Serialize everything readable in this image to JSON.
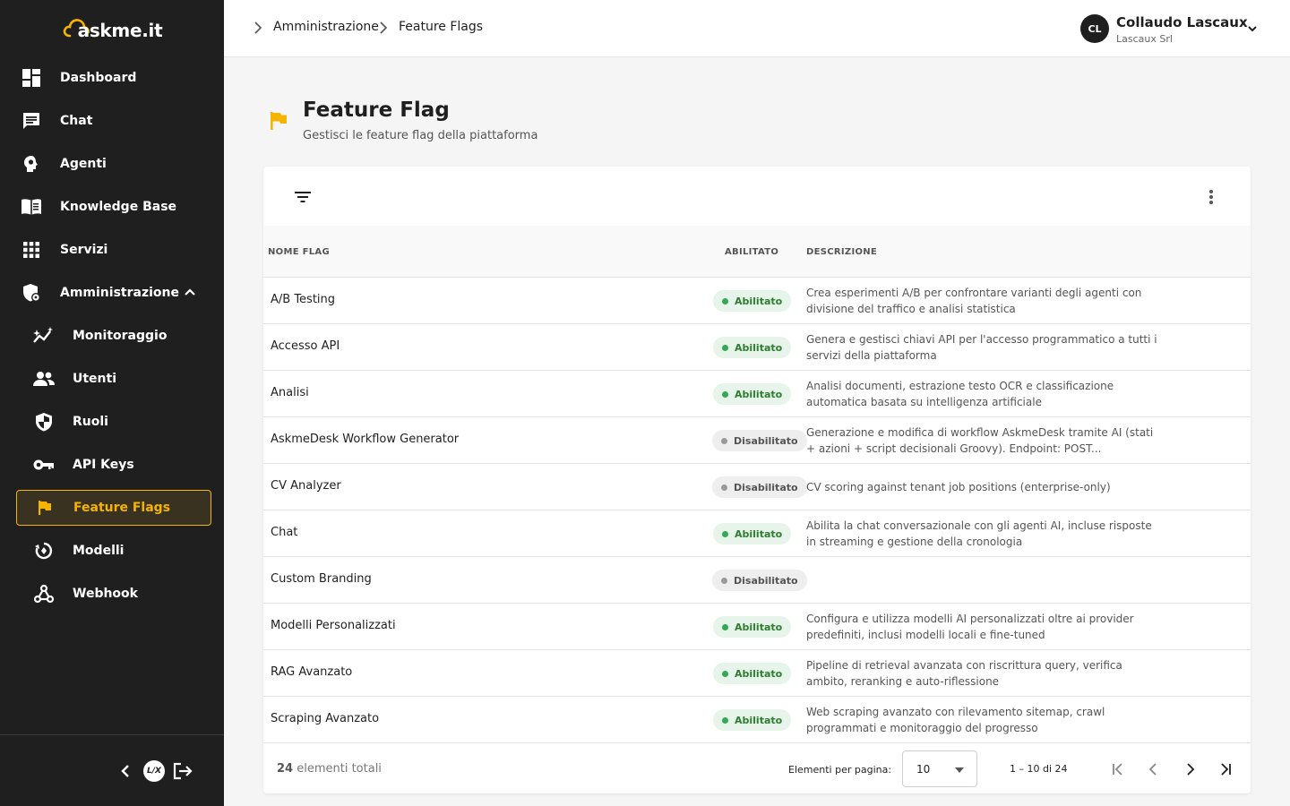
{
  "app": {
    "logo_text": "askme.it"
  },
  "sidebar": {
    "items": [
      {
        "label": "Dashboard",
        "icon": "dashboard-icon"
      },
      {
        "label": "Chat",
        "icon": "chat-icon"
      },
      {
        "label": "Agenti",
        "icon": "agent-icon"
      },
      {
        "label": "Knowledge Base",
        "icon": "book-icon"
      },
      {
        "label": "Servizi",
        "icon": "apps-icon"
      },
      {
        "label": "Amministrazione",
        "icon": "admin-icon",
        "expanded": true
      }
    ],
    "sub_items": [
      {
        "label": "Monitoraggio",
        "icon": "monitoring-icon"
      },
      {
        "label": "Utenti",
        "icon": "users-icon"
      },
      {
        "label": "Ruoli",
        "icon": "shield-icon"
      },
      {
        "label": "API Keys",
        "icon": "key-icon"
      },
      {
        "label": "Feature Flags",
        "icon": "flag-icon",
        "active": true
      },
      {
        "label": "Modelli",
        "icon": "model-icon"
      },
      {
        "label": "Webhook",
        "icon": "webhook-icon"
      }
    ],
    "footer_brand": "L/X",
    "accent_color": "#f5b400"
  },
  "topbar": {
    "breadcrumb": [
      "Amministrazione",
      "Feature Flags"
    ],
    "user": {
      "initials": "CL",
      "name": "Collaudo Lascaux",
      "org": "Lascaux Srl"
    }
  },
  "page": {
    "title": "Feature Flag",
    "subtitle": "Gestisci le feature flag della piattaforma"
  },
  "table": {
    "columns": {
      "name": "NOME FLAG",
      "enabled": "ABILITATO",
      "description": "DESCRIZIONE"
    },
    "rows": [
      {
        "name": "A/B Testing",
        "status": "Abilitato",
        "enabled": true,
        "description": "Crea esperimenti A/B per confrontare varianti degli agenti con divisione del traffico e analisi statistica"
      },
      {
        "name": "Accesso API",
        "status": "Abilitato",
        "enabled": true,
        "description": "Genera e gestisci chiavi API per l'accesso programmatico a tutti i servizi della piattaforma"
      },
      {
        "name": "Analisi",
        "status": "Abilitato",
        "enabled": true,
        "description": "Analisi documenti, estrazione testo OCR e classificazione automatica basata su intelligenza artificiale"
      },
      {
        "name": "AskmeDesk Workflow Generator",
        "status": "Disabilitato",
        "enabled": false,
        "description": "Generazione e modifica di workflow AskmeDesk tramite AI (stati + azioni + script decisionali Groovy). Endpoint: POST..."
      },
      {
        "name": "CV Analyzer",
        "status": "Disabilitato",
        "enabled": false,
        "description": "CV scoring against tenant job positions (enterprise-only)"
      },
      {
        "name": "Chat",
        "status": "Abilitato",
        "enabled": true,
        "description": "Abilita la chat conversazionale con gli agenti AI, incluse risposte in streaming e gestione della cronologia"
      },
      {
        "name": "Custom Branding",
        "status": "Disabilitato",
        "enabled": false,
        "description": ""
      },
      {
        "name": "Modelli Personalizzati",
        "status": "Abilitato",
        "enabled": true,
        "description": "Configura e utilizza modelli AI personalizzati oltre ai provider predefiniti, inclusi modelli locali e fine-tuned"
      },
      {
        "name": "RAG Avanzato",
        "status": "Abilitato",
        "enabled": true,
        "description": "Pipeline di retrieval avanzata con riscrittura query, verifica ambito, reranking e auto-riflessione"
      },
      {
        "name": "Scraping Avanzato",
        "status": "Abilitato",
        "enabled": true,
        "description": "Web scraping avanzato con rilevamento sitemap, crawl programmati e monitoraggio del progresso"
      }
    ]
  },
  "paginator": {
    "total_count": "24",
    "total_suffix": "elementi totali",
    "page_size_label": "Elementi per pagina:",
    "page_size": "10",
    "range": "1 – 10 di 24"
  }
}
